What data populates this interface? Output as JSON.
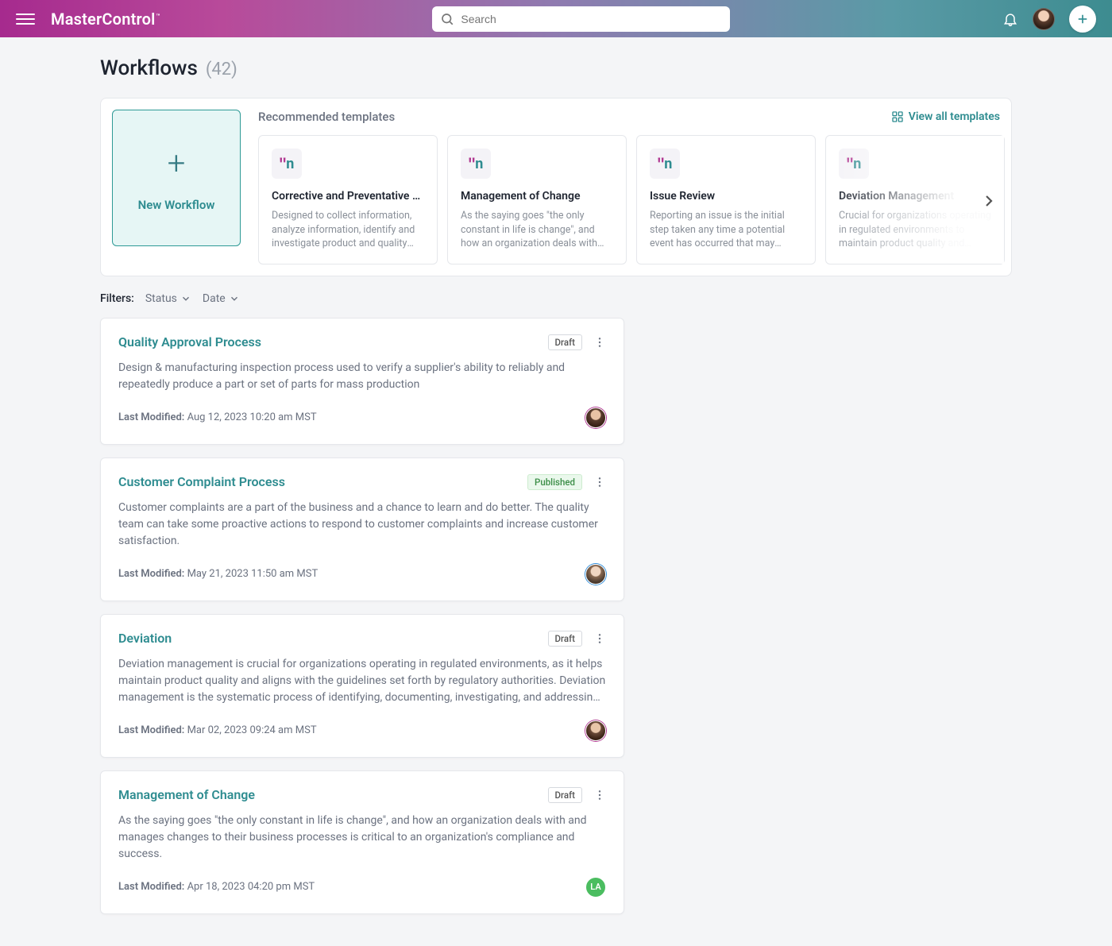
{
  "header": {
    "brand": "MasterControl",
    "search_placeholder": "Search"
  },
  "page": {
    "title": "Workflows",
    "count": "(42)"
  },
  "recommended": {
    "heading": "Recommended templates",
    "view_all": "View all templates",
    "new_workflow": "New Workflow",
    "templates": [
      {
        "title": "Corrective and Preventative A...",
        "desc": "Designed to collect information, analyze information, identify and investigate product and quality prob..."
      },
      {
        "title": "Management of Change",
        "desc": "As the saying goes \"the only constant in life is change\", and how an organization deals with and manage..."
      },
      {
        "title": "Issue Review",
        "desc": "Reporting an issue is the initial step taken any time a potential event has occurred that may impact the qualit..."
      },
      {
        "title": "Deviation Management",
        "desc": "Crucial for organizations operating in regulated environments to maintain product quality and align..."
      }
    ]
  },
  "filters": {
    "label": "Filters:",
    "status": "Status",
    "date": "Date"
  },
  "workflows": [
    {
      "title": "Quality Approval Process",
      "status": "Draft",
      "status_type": "draft",
      "desc": "Design & manufacturing inspection process used to verify a supplier's ability to reliably and repeatedly produce a part or set of parts for mass production",
      "modified_label": "Last Modified:",
      "modified": "Aug 12, 2023 10:20 am MST",
      "avatar": "a1",
      "avatar_initials": ""
    },
    {
      "title": "Customer Complaint Process",
      "status": "Published",
      "status_type": "pub",
      "desc": "Customer complaints are a part of the business and a chance to learn and do better. The quality team can take some proactive actions to respond to customer complaints and increase customer satisfaction.",
      "modified_label": "Last Modified:",
      "modified": "May 21, 2023 11:50 am MST",
      "avatar": "a2",
      "avatar_initials": ""
    },
    {
      "title": "Deviation",
      "status": "Draft",
      "status_type": "draft",
      "desc": "Deviation management is crucial for organizations operating in regulated environments, as it helps maintain product quality and aligns with the guidelines set forth by regulatory authorities. Deviation management is the systematic process of identifying, documenting, investigating, and addressing any unexpected or unplanned...",
      "modified_label": "Last Modified:",
      "modified": "Mar 02, 2023 09:24 am MST",
      "avatar": "a3",
      "avatar_initials": ""
    },
    {
      "title": "Management of Change",
      "status": "Draft",
      "status_type": "draft",
      "desc": "As the saying goes \"the only constant in life is change\", and how an organization deals with and manages changes to their business processes is critical to an organization's compliance and success.",
      "modified_label": "Last Modified:",
      "modified": "Apr 18, 2023 04:20 pm MST",
      "avatar": "a4",
      "avatar_initials": "LA"
    }
  ]
}
